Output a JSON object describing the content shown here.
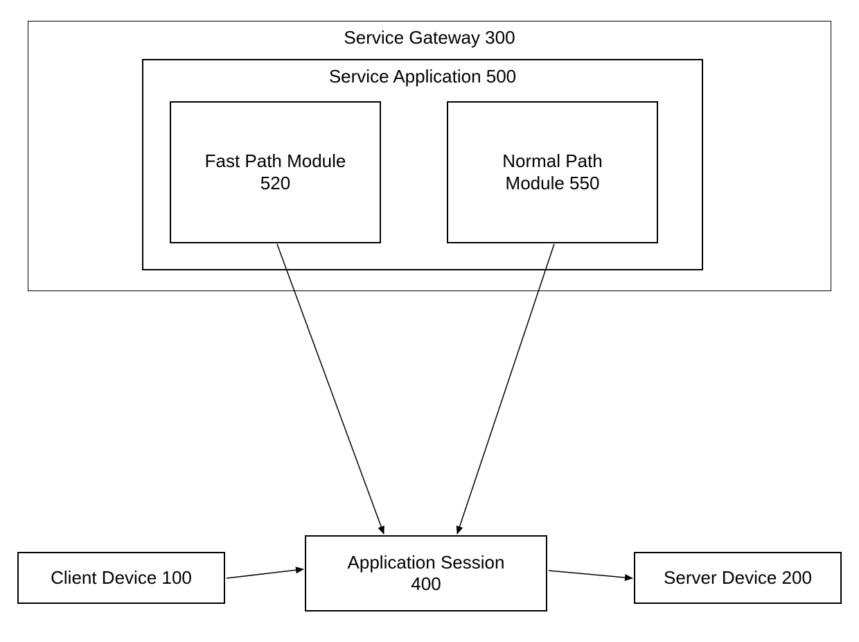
{
  "diagram": {
    "gateway_title": "Service Gateway 300",
    "application_title": "Service Application 500",
    "fast_path": {
      "line1": "Fast Path Module",
      "line2": "520"
    },
    "normal_path": {
      "line1": "Normal Path",
      "line2": "Module 550"
    },
    "app_session": {
      "line1": "Application Session",
      "line2": "400"
    },
    "client_device": "Client Device 100",
    "server_device": "Server Device 200"
  },
  "chart_data": {
    "type": "diagram",
    "nodes": [
      {
        "id": "gateway",
        "label": "Service Gateway 300",
        "contains": [
          "application"
        ]
      },
      {
        "id": "application",
        "label": "Service Application 500",
        "contains": [
          "fast_path",
          "normal_path"
        ]
      },
      {
        "id": "fast_path",
        "label": "Fast Path Module 520"
      },
      {
        "id": "normal_path",
        "label": "Normal Path Module 550"
      },
      {
        "id": "app_session",
        "label": "Application Session 400"
      },
      {
        "id": "client_device",
        "label": "Client Device 100"
      },
      {
        "id": "server_device",
        "label": "Server Device 200"
      }
    ],
    "edges": [
      {
        "from": "fast_path",
        "to": "app_session",
        "directed": true
      },
      {
        "from": "normal_path",
        "to": "app_session",
        "directed": true
      },
      {
        "from": "client_device",
        "to": "app_session",
        "directed": true
      },
      {
        "from": "app_session",
        "to": "server_device",
        "directed": true
      }
    ]
  }
}
